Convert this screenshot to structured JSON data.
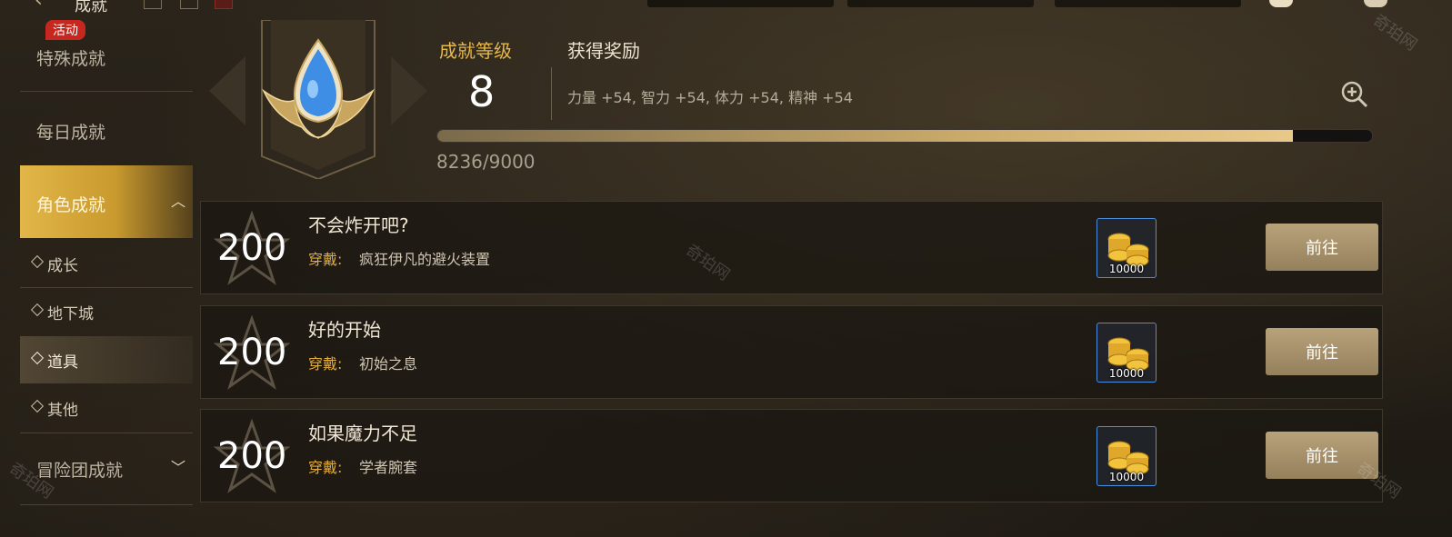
{
  "topbar": {
    "title": "成就",
    "currencies": [
      "",
      "",
      ""
    ]
  },
  "sidebar": {
    "badge": "活动",
    "categories": [
      {
        "label": "特殊成就"
      },
      {
        "label": "每日成就"
      },
      {
        "label": "角色成就"
      },
      {
        "label": "冒险团成就"
      }
    ],
    "sub_items": [
      {
        "label": "成长"
      },
      {
        "label": "地下城"
      },
      {
        "label": "道具"
      },
      {
        "label": "其他"
      }
    ]
  },
  "header": {
    "level_label": "成就等级",
    "level_value": "8",
    "reward_label": "获得奖励",
    "reward_text": "力量 +54, 智力 +54, 体力 +54, 精神 +54",
    "progress_text": "8236/9000",
    "progress_fraction": 0.915
  },
  "achievements": [
    {
      "points": "200",
      "title": "不会炸开吧?",
      "wear_label": "穿戴:",
      "item": "疯狂伊凡的避火装置",
      "reward_amount": "10000",
      "button": "前往"
    },
    {
      "points": "200",
      "title": "好的开始",
      "wear_label": "穿戴:",
      "item": "初始之息",
      "reward_amount": "10000",
      "button": "前往"
    },
    {
      "points": "200",
      "title": "如果魔力不足",
      "wear_label": "穿戴:",
      "item": "学者腕套",
      "reward_amount": "10000",
      "button": "前往"
    }
  ],
  "watermark": "奇珀网",
  "colors": {
    "accent_gold": "#e7b84a",
    "active_tab": "#d9a93a",
    "reward_border": "#4a8ee0"
  },
  "icons": {
    "back": "back-arrow-icon",
    "zoom": "zoom-in-icon",
    "collapse": "chevron-up-icon",
    "expand": "chevron-down-icon"
  }
}
